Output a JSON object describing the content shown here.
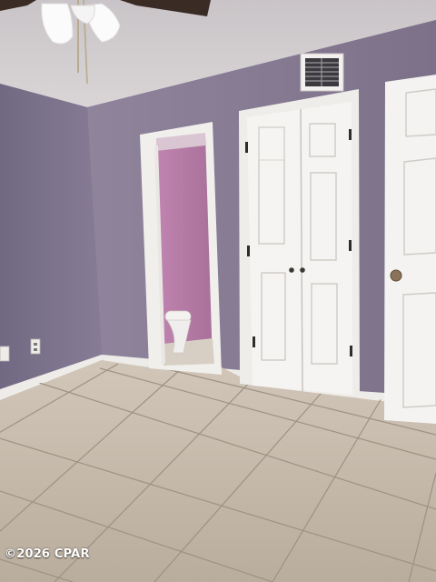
{
  "photo": {
    "watermark": "©2026 CPAR",
    "subject_elements": [
      "ceiling-fan",
      "air-vent",
      "bathroom-doorway",
      "toilet",
      "double-closet-door",
      "entry-door",
      "tile-floor",
      "outlet"
    ],
    "colors": {
      "wall": "#8a7f97",
      "wall_dark": "#6f6780",
      "ceiling": "#d2cdd0",
      "bathroom_wall": "#b27aa2",
      "trim": "#f2f0ee",
      "door": "#f4f3f1",
      "floor": "#c4b8a9",
      "grout": "#9c9182"
    }
  }
}
